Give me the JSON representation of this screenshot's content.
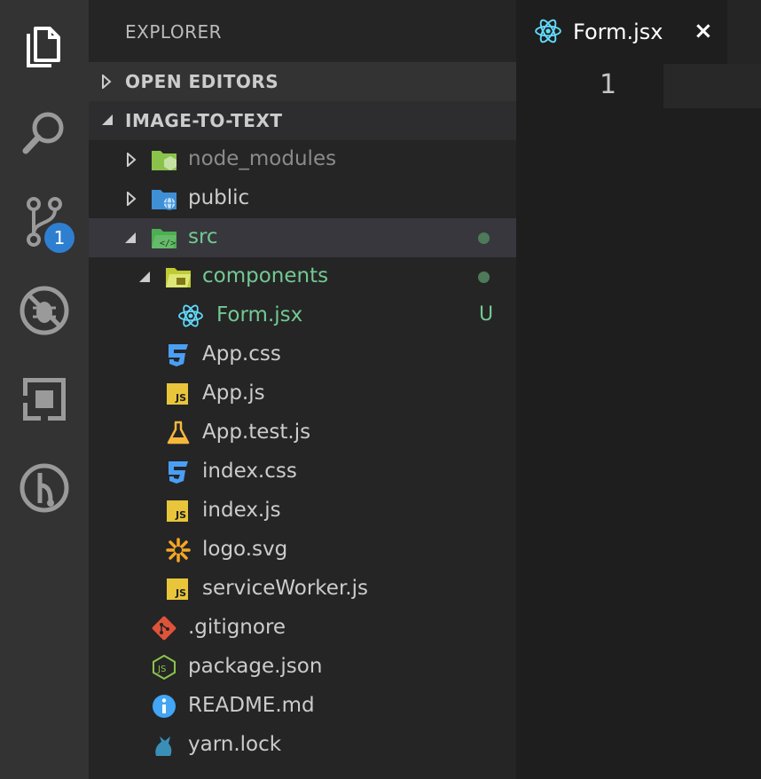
{
  "activity_bar": {
    "items": [
      {
        "icon": "files-icon"
      },
      {
        "icon": "search-icon"
      },
      {
        "icon": "source-control-icon",
        "badge": "1"
      },
      {
        "icon": "debug-icon"
      },
      {
        "icon": "extensions-icon"
      },
      {
        "icon": "gitlens-icon"
      }
    ]
  },
  "sidebar": {
    "title": "EXPLORER",
    "sections": {
      "open_editors": "OPEN EDITORS",
      "project": "IMAGE-TO-TEXT"
    },
    "tree": [
      {
        "name": "node_modules",
        "icon": "folder-node-icon"
      },
      {
        "name": "public",
        "icon": "folder-public-icon"
      },
      {
        "name": "src",
        "icon": "folder-src-icon"
      },
      {
        "name": "components",
        "icon": "folder-components-icon"
      },
      {
        "name": "Form.jsx",
        "icon": "react-icon",
        "status": "U"
      },
      {
        "name": "App.css",
        "icon": "css-icon"
      },
      {
        "name": "App.js",
        "icon": "js-icon",
        "icon_text": "JS"
      },
      {
        "name": "App.test.js",
        "icon": "test-flask-icon"
      },
      {
        "name": "index.css",
        "icon": "css-icon"
      },
      {
        "name": "index.js",
        "icon": "js-icon",
        "icon_text": "JS"
      },
      {
        "name": "logo.svg",
        "icon": "svg-icon"
      },
      {
        "name": "serviceWorker.js",
        "icon": "js-icon",
        "icon_text": "JS"
      },
      {
        "name": ".gitignore",
        "icon": "git-icon"
      },
      {
        "name": "package.json",
        "icon": "nodejs-icon"
      },
      {
        "name": "README.md",
        "icon": "info-icon"
      },
      {
        "name": "yarn.lock",
        "icon": "yarn-icon"
      }
    ]
  },
  "editor": {
    "tab": {
      "label": "Form.jsx",
      "close": "×"
    },
    "line_number": "1"
  },
  "colors": {
    "accent_badge": "#2f7fd1",
    "untracked_green": "#73c991",
    "js_yellow": "#e8c53a",
    "css_blue": "#4a9ff5",
    "react_cyan": "#61dafb"
  }
}
